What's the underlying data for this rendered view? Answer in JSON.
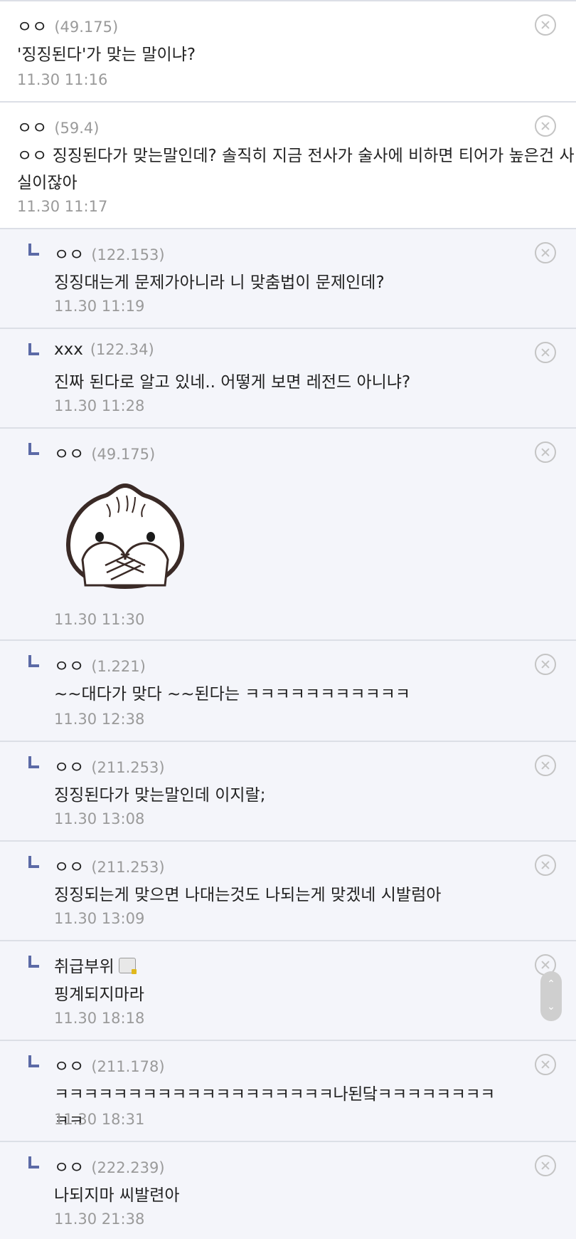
{
  "comments": [
    {
      "author": "ㅇㅇ",
      "ip": "(49.175)",
      "text": "'징징된다'가 맞는 말이냐?",
      "time": "11.30 11:16"
    },
    {
      "author": "ㅇㅇ",
      "ip": "(59.4)",
      "text": "ㅇㅇ 징징된다가 맞는말인데? 솔직히 지금 전사가 술사에 비하면 티어가 높은건 사실이잖아",
      "time": "11.30 11:17"
    },
    {
      "author": "ㅇㅇ",
      "ip": "(122.153)",
      "text": "징징대는게 문제가아니라 니 맞춤법이 문제인데?",
      "time": "11.30 11:19"
    },
    {
      "author": "xxx",
      "ip": "(122.34)",
      "text": "진짜 된다로 알고 있네.. 어떻게 보면 레전드 아니냐?",
      "time": "11.30 11:28"
    },
    {
      "author": "ㅇㅇ",
      "ip": "(49.175)",
      "text": "",
      "time": "11.30 11:30",
      "sticker": "covering-mouth-dumpling"
    },
    {
      "author": "ㅇㅇ",
      "ip": "(1.221)",
      "text": "~~대다가 맞다 ~~된다는 ㅋㅋㅋㅋㅋㅋㅋㅋㅋㅋㅋ",
      "time": "11.30 12:38"
    },
    {
      "author": "ㅇㅇ",
      "ip": "(211.253)",
      "text": "징징된다가 맞는말인데 이지랄;",
      "time": "11.30 13:08"
    },
    {
      "author": "ㅇㅇ",
      "ip": "(211.253)",
      "text": "징징되는게 맞으면 나대는것도 나되는게 맞겠네 시발럼아",
      "time": "11.30 13:09"
    },
    {
      "author": "취급부위",
      "ip": "",
      "text": "핑계되지마라",
      "time": "11.30 18:18",
      "badge": "member-icon"
    },
    {
      "author": "ㅇㅇ",
      "ip": "(211.178)",
      "text": "ㅋㅋㅋㅋㅋㅋㅋㅋㅋㅋㅋㅋㅋㅋㅋㅋㅋㅋㅋ나된닼ㅋㅋㅋㅋㅋㅋㅋㅋㅋㅋ",
      "time": "11.30 18:31"
    },
    {
      "author": "ㅇㅇ",
      "ip": "(222.239)",
      "text": "나되지마 씨발련아",
      "time": "11.30 21:38"
    }
  ],
  "scroll_widget": {
    "up": "⌃",
    "down": "⌄"
  },
  "colors": {
    "reply_bg": "#f4f5fa",
    "divider": "#dcdfe6",
    "reply_mark": "#5c6aa6",
    "meta_text": "#9a9a9a"
  }
}
